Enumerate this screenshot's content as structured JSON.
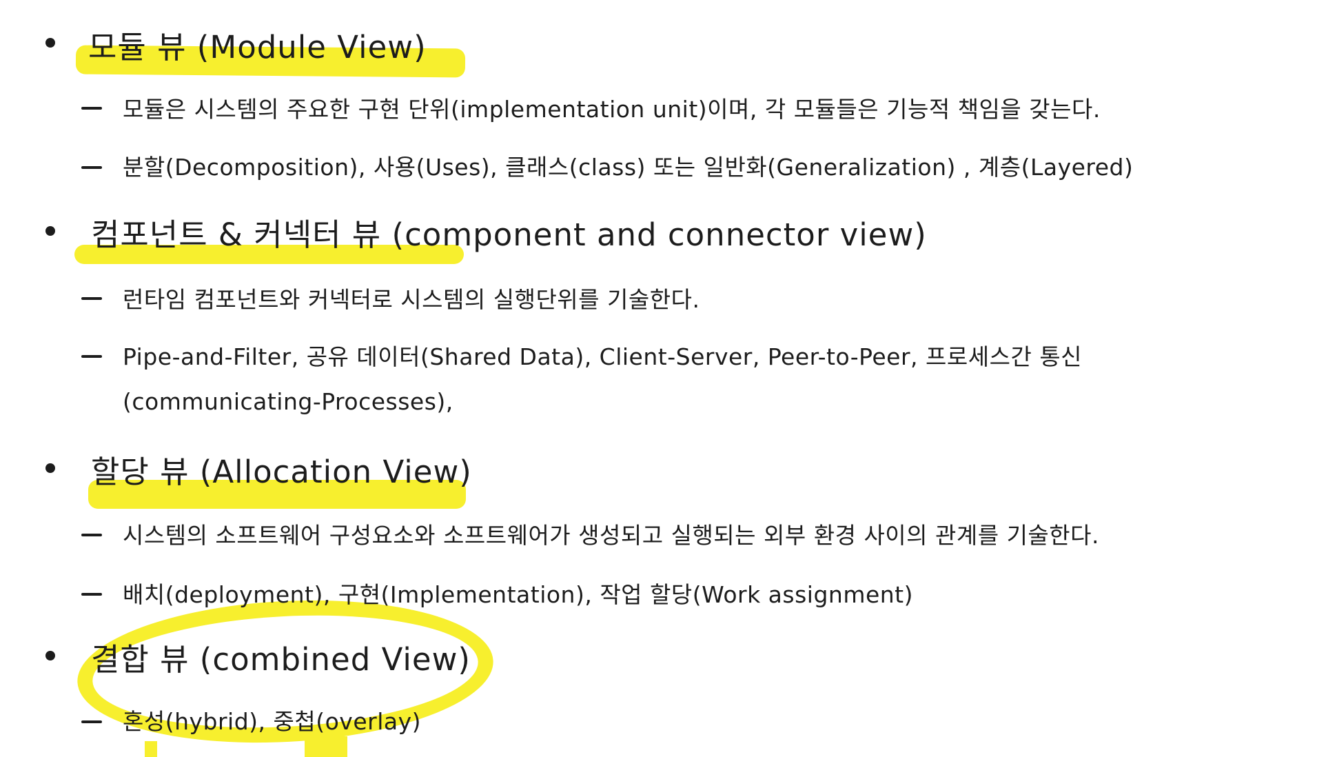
{
  "sections": [
    {
      "heading": "모듈 뷰 (Module View)",
      "items": [
        "모듈은 시스템의 주요한 구현 단위(implementation unit)이며, 각 모듈들은 기능적 책임을 갖는다.",
        "분할(Decomposition), 사용(Uses), 클래스(class) 또는 일반화(Generalization) , 계층(Layered)"
      ]
    },
    {
      "heading": "컴포넌트 & 커넥터 뷰 (component and connector view)",
      "items": [
        "런타임 컴포넌트와 커넥터로 시스템의 실행단위를 기술한다.",
        "Pipe-and-Filter, 공유 데이터(Shared Data), Client-Server, Peer-to-Peer, 프로세스간 통신",
        "(communicating-Processes),"
      ]
    },
    {
      "heading": "할당 뷰 (Allocation View)",
      "items": [
        "시스템의 소프트웨어 구성요소와 소프트웨어가 생성되고 실행되는 외부 환경 사이의 관계를 기술한다.",
        "배치(deployment), 구현(Implementation), 작업 할당(Work assignment)"
      ]
    },
    {
      "heading": "결합 뷰 (combined View)",
      "items": [
        "혼성(hybrid), 중첩(overlay)"
      ]
    }
  ],
  "highlight_color": "#f7ef2e"
}
